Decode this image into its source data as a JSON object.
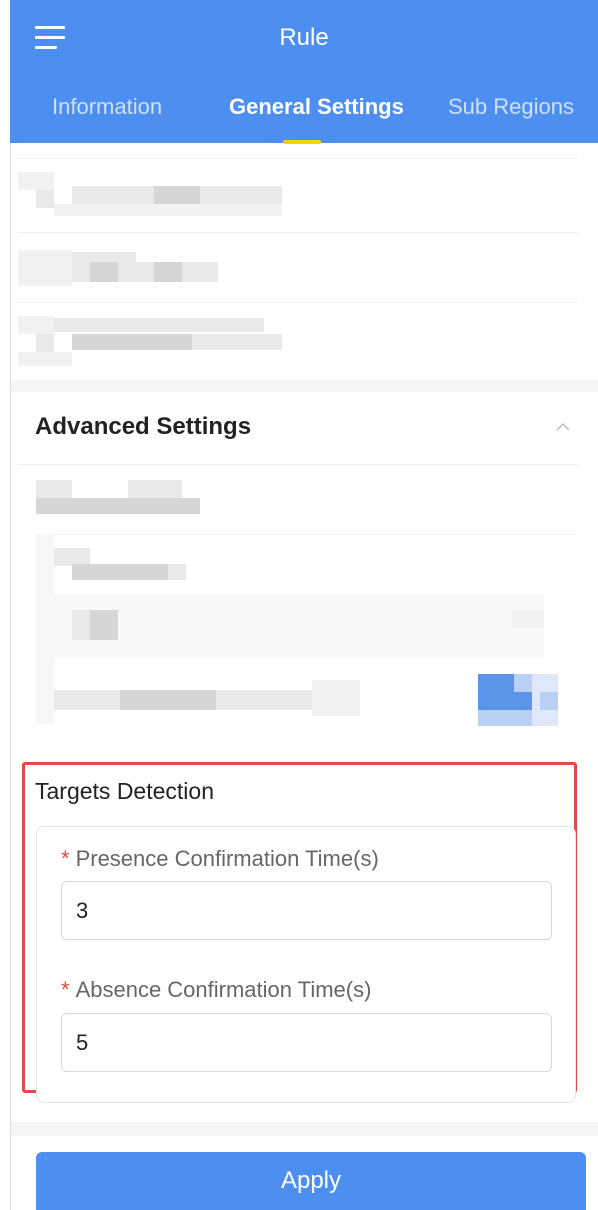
{
  "header": {
    "title": "Rule"
  },
  "tabs": [
    {
      "label": "Information",
      "active": false
    },
    {
      "label": "General Settings",
      "active": true
    },
    {
      "label": "Sub Regions",
      "active": false
    }
  ],
  "advanced_settings": {
    "title": "Advanced Settings"
  },
  "targets_detection": {
    "title": "Targets Detection",
    "fields": [
      {
        "label": "Presence Confirmation Time(s)",
        "required_marker": "*",
        "value": "3"
      },
      {
        "label": "Absence Confirmation Time(s)",
        "required_marker": "*",
        "value": "5"
      }
    ]
  },
  "footer": {
    "apply_label": "Apply"
  },
  "colors": {
    "primary": "#4d8ff0",
    "active_tab_indicator": "#ffd000",
    "highlight": "#e24b44",
    "required": "#e24b44"
  }
}
